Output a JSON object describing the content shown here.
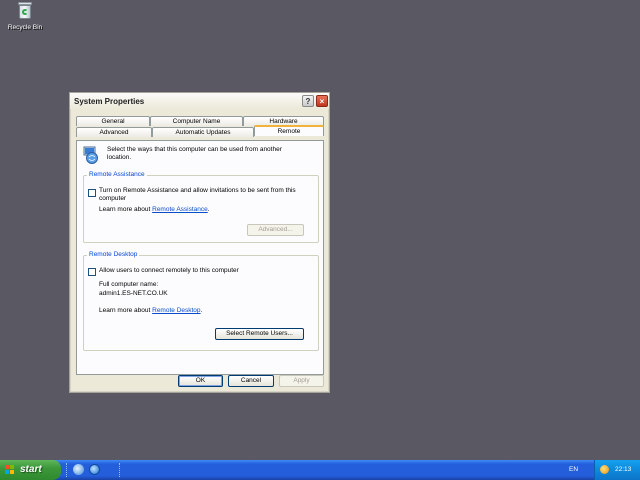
{
  "desktop": {
    "recycle_bin_label": "Recycle Bin"
  },
  "window": {
    "title": "System Properties",
    "help_label": "?",
    "close_label": "×",
    "tabs_row1": [
      "General",
      "Computer Name",
      "Hardware"
    ],
    "tabs_row2": [
      "Advanced",
      "Automatic Updates",
      "Remote"
    ],
    "active_tab": "Remote",
    "intro_line1": "Select the ways that this computer can be used from another",
    "intro_line2": "location.",
    "remote_assistance": {
      "title": "Remote Assistance",
      "checkbox_line1": "Turn on Remote Assistance and allow invitations to be sent from this",
      "checkbox_line2": "computer",
      "checked": false,
      "learn_prefix": "Learn more about",
      "learn_link": "Remote Assistance",
      "learn_suffix": ".",
      "advanced_button": "Advanced..."
    },
    "remote_desktop": {
      "title": "Remote Desktop",
      "checkbox_label": "Allow users to connect remotely to this computer",
      "checked": false,
      "full_name_label": "Full computer name:",
      "full_name_value": "admin1.ES-NET.CO.UK",
      "learn_prefix": "Learn more about",
      "learn_link": "Remote Desktop",
      "learn_suffix": ".",
      "select_users_button": "Select Remote Users..."
    },
    "buttons": {
      "ok": "OK",
      "cancel": "Cancel",
      "apply": "Apply"
    }
  },
  "taskbar": {
    "start_label": "start",
    "language": "EN",
    "clock": "22:13"
  },
  "colors": {
    "desktop": "#595863",
    "taskbar": "#245edb",
    "start_button": "#3c983b",
    "link": "#0b4cc8",
    "group_title": "#0046d5"
  }
}
